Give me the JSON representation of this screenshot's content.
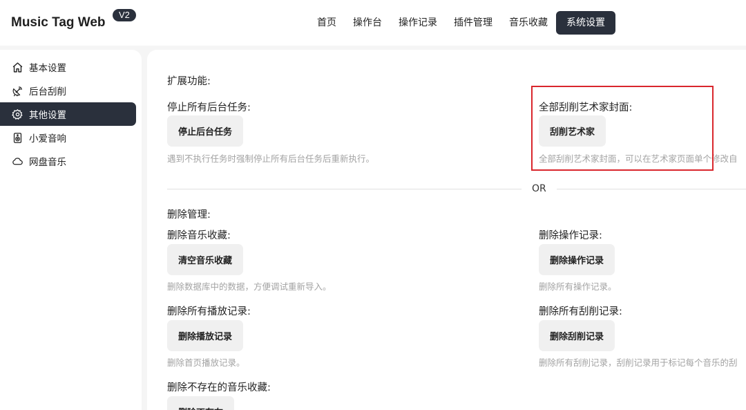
{
  "header": {
    "brand": "Music Tag Web",
    "version": "V2",
    "nav": [
      "首页",
      "操作台",
      "操作记录",
      "插件管理",
      "音乐收藏",
      "系统设置"
    ]
  },
  "sidebar": {
    "items": [
      {
        "label": "基本设置",
        "icon": "home-icon"
      },
      {
        "label": "后台刮削",
        "icon": "satellite-dish-icon"
      },
      {
        "label": "其他设置",
        "icon": "gear-icon"
      },
      {
        "label": "小爱音响",
        "icon": "speaker-icon"
      },
      {
        "label": "网盘音乐",
        "icon": "cloud-icon"
      }
    ],
    "active": "其他设置"
  },
  "main": {
    "extensions_title": "扩展功能:",
    "stop_tasks": {
      "label": "停止所有后台任务:",
      "button": "停止后台任务",
      "hint": "遇到不执行任务时强制停止所有后台任务后重新执行。"
    },
    "scrape_artists": {
      "label": "全部刮削艺术家封面:",
      "button": "刮削艺术家",
      "hint": "全部刮削艺术家封面，可以在艺术家页面单个修改自"
    },
    "divider": "OR",
    "delete_title": "删除管理:",
    "delete_favorites": {
      "label": "删除音乐收藏:",
      "button": "清空音乐收藏",
      "hint": "删除数据库中的数据，方便调试重新导入。"
    },
    "delete_operation_records": {
      "label": "删除操作记录:",
      "button": "删除操作记录",
      "hint": "删除所有操作记录。"
    },
    "delete_play_records": {
      "label": "删除所有播放记录:",
      "button": "删除播放记录",
      "hint": "删除首页播放记录。"
    },
    "delete_scrape_records": {
      "label": "删除所有刮削记录:",
      "button": "删除刮削记录",
      "hint": "删除所有刮削记录，刮削记录用于标记每个音乐的刮"
    },
    "delete_missing_favorites": {
      "label": "删除不存在的音乐收藏:",
      "button": "删除不存在"
    }
  },
  "colors": {
    "accent": "#2a303c",
    "highlight_border": "#d9262c",
    "hint_text": "#a3a3a3",
    "button_bg": "#f0f0f0"
  }
}
